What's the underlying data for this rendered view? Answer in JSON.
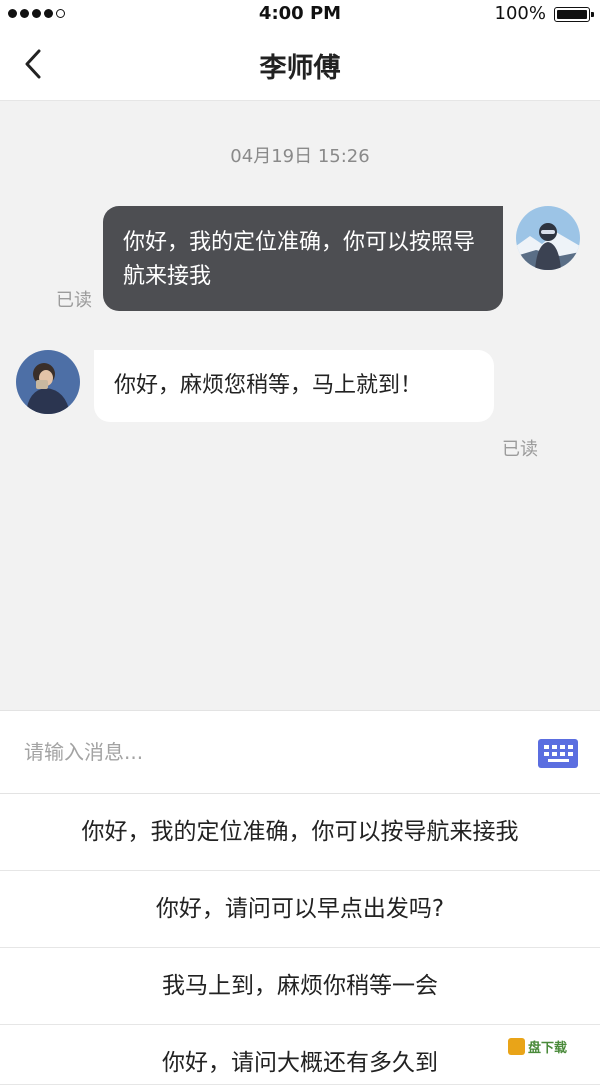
{
  "status": {
    "time": "4:00 PM",
    "battery": "100%"
  },
  "nav": {
    "title": "李师傅"
  },
  "chat": {
    "timestamp": "04月19日 15:26",
    "outgoing": "你好，我的定位准确，你可以按照导航来接我",
    "outgoing_read": "已读",
    "incoming": "你好，麻烦您稍等，马上就到！",
    "incoming_read": "已读"
  },
  "input": {
    "placeholder": "请输入消息..."
  },
  "quick_replies": [
    "你好，我的定位准确，你可以按导航来接我",
    "你好，请问可以早点出发吗?",
    "我马上到，麻烦你稍等一会",
    "你好，请问大概还有多久到"
  ],
  "watermark": {
    "text": "盘下载"
  }
}
